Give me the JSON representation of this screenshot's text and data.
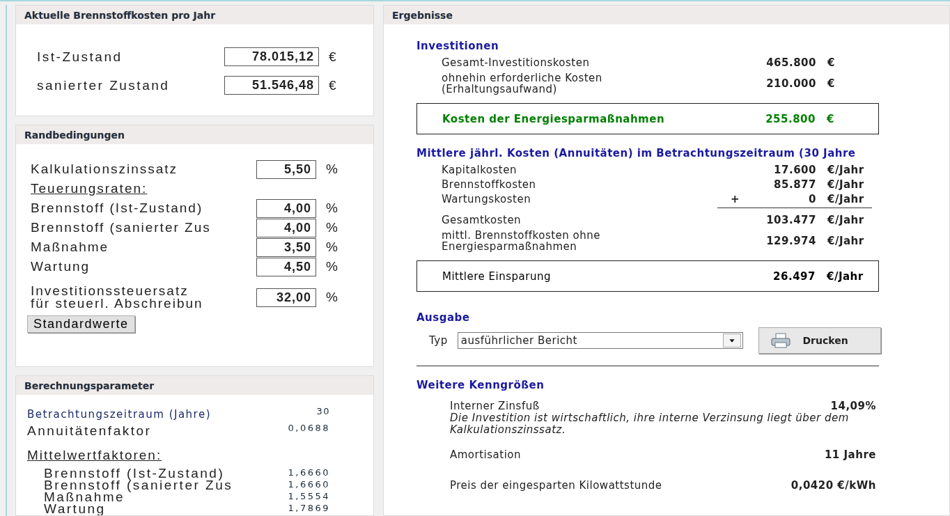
{
  "fuel_costs": {
    "title": "Aktuelle Brennstoffkosten pro Jahr",
    "rows": [
      {
        "label": "Ist-Zustand",
        "value": "78.015,12",
        "unit": "€"
      },
      {
        "label": "sanierter Zustand",
        "value": "51.546,48",
        "unit": "€"
      }
    ]
  },
  "conditions": {
    "title": "Randbedingungen",
    "rows": [
      {
        "kind": "field",
        "label": "Kalkulationszinssatz",
        "value": "5,50",
        "unit": "%"
      },
      {
        "kind": "subheading",
        "label": "Teuerungsraten:"
      },
      {
        "kind": "field",
        "label": "Brennstoff (Ist-Zustand)",
        "value": "4,00",
        "unit": "%"
      },
      {
        "kind": "field",
        "label": "Brennstoff (sanierter Zus",
        "value": "4,00",
        "unit": "%"
      },
      {
        "kind": "field",
        "label": "Maßnahme",
        "value": "3,50",
        "unit": "%"
      },
      {
        "kind": "field",
        "label": "Wartung",
        "value": "4,50",
        "unit": "%"
      },
      {
        "kind": "field2",
        "label": "Investitionssteuersatz",
        "label2": "für steuerl. Abschreibun",
        "value": "32,00",
        "unit": "%"
      }
    ],
    "button": "Standardwerte"
  },
  "parameters": {
    "title": "Berechnungsparameter",
    "rows": [
      {
        "kind": "small",
        "label": "Betrachtungszeitraum (Jahre)",
        "value": "30"
      },
      {
        "kind": "large",
        "label": "Annuitätenfaktor",
        "value": "0,0688"
      },
      {
        "kind": "subheading",
        "label": "Mittelwertfaktoren:"
      },
      {
        "kind": "indented",
        "label": "Brennstoff (Ist-Zustand)",
        "value": "1,6660"
      },
      {
        "kind": "indented",
        "label": "Brennstoff (sanierter Zus",
        "value": "1,6660"
      },
      {
        "kind": "indented",
        "label": "Maßnahme",
        "value": "1,5554"
      },
      {
        "kind": "indented",
        "label": "Wartung",
        "value": "1,7869"
      }
    ]
  },
  "results": {
    "title": "Ergebnisse",
    "investments": {
      "heading": "Investitionen",
      "rows": [
        {
          "kind": "item",
          "label": "Gesamt-Investitionskosten",
          "value": "465.800",
          "unit": "€"
        },
        {
          "kind": "item",
          "label": "ohnehin erforderliche Kosten",
          "label2": "(Erhaltungsaufwand)",
          "value": "210.000",
          "unit": "€"
        },
        {
          "kind": "boxed",
          "label": "Kosten der Energiesparmaßnahmen",
          "value": "255.800",
          "unit": "€",
          "color": "#008000"
        }
      ]
    },
    "annuities": {
      "heading": "Mittlere jährl. Kosten (Annuitäten) im Betrachtungszeitraum (30 Jahre",
      "rows": [
        {
          "kind": "item",
          "label": "Kapitalkosten",
          "value": "17.600",
          "unit": "€/Jahr"
        },
        {
          "kind": "item",
          "label": "Brennstoffkosten",
          "value": "85.877",
          "unit": "€/Jahr"
        },
        {
          "kind": "item",
          "label": "Wartungskosten",
          "operator": "+",
          "value": "0",
          "unit": "€/Jahr"
        },
        {
          "kind": "total",
          "label": "Gesamtkosten",
          "value": "103.477",
          "unit": "€/Jahr"
        },
        {
          "kind": "item",
          "label": "mittl. Brennstoffkosten ohne",
          "label2": "Energiesparmaßnahmen",
          "value": "129.974",
          "unit": "€/Jahr"
        },
        {
          "kind": "boxed",
          "label": "Mittlere Einsparung",
          "value": "26.497",
          "unit": "€/Jahr",
          "color": "#000000"
        }
      ]
    },
    "output": {
      "heading": "Ausgabe",
      "type_label": "Typ",
      "type_value": "ausführlicher Bericht",
      "print_button": "Drucken"
    },
    "metrics": {
      "heading": "Weitere Kenngrößen",
      "rows": [
        {
          "label": "Interner Zinsfuß",
          "value": "14,09%",
          "note": "Die Investition ist wirtschaftlich, ihre interne Verzinsung liegt über dem Kalkulationszinssatz."
        },
        {
          "label": "Amortisation",
          "value": "11 Jahre"
        },
        {
          "label": "Preis der eingesparten Kilowattstunde",
          "value": "0,0420 €/kWh"
        }
      ]
    }
  }
}
